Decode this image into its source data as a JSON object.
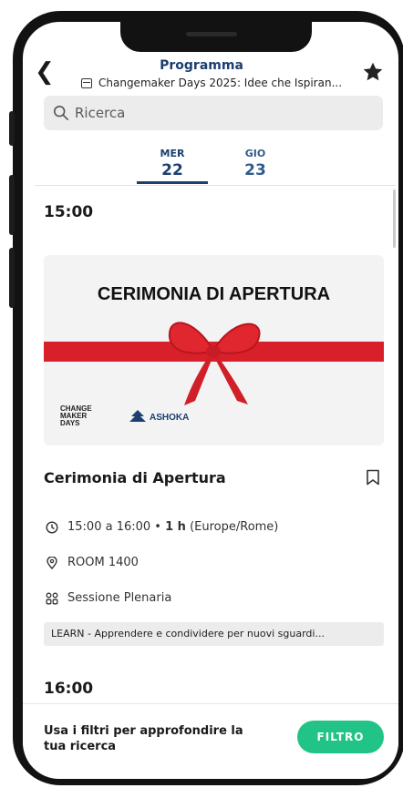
{
  "header": {
    "title": "Programma",
    "subtitle": "Changemaker Days 2025: Idee che Ispiran..."
  },
  "search": {
    "placeholder": "Ricerca"
  },
  "days": [
    {
      "name": "MER",
      "number": "22",
      "active": true
    },
    {
      "name": "GIO",
      "number": "23",
      "active": false
    }
  ],
  "schedule": {
    "time_1": "15:00",
    "banner": {
      "title": "CERIMONIA DI APERTURA",
      "logo_1": "CHANGE MAKER DAYS",
      "logo_2": "ASHOKA"
    },
    "session": {
      "title": "Cerimonia di Apertura",
      "time_range": "15:00 a 16:00",
      "duration": "1 h",
      "timezone": "(Europe/Rome)",
      "room": "ROOM 1400",
      "type": "Sessione Plenaria",
      "tag": "LEARN - Apprendere e condividere per nuovi sguardi..."
    },
    "time_2": "16:00"
  },
  "footer": {
    "text": "Usa i filtri per approfondire la tua ricerca",
    "button": "FILTRO"
  },
  "colors": {
    "primary": "#1c3f70",
    "accent_green": "#21c486",
    "ribbon": "#d8202a"
  }
}
